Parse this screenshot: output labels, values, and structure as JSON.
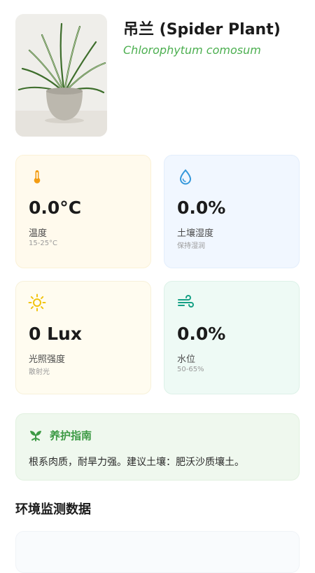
{
  "plant": {
    "name": "吊兰 (Spider Plant)",
    "scientific_name": "Chlorophytum comosum"
  },
  "metrics": [
    {
      "icon": "thermometer-icon",
      "value": "0.0°C",
      "label": "温度",
      "sub": "15-25°C",
      "accent": "#f39c12"
    },
    {
      "icon": "water-drop-icon",
      "value": "0.0%",
      "label": "土壤湿度",
      "sub": "保持湿润",
      "accent": "#3498db"
    },
    {
      "icon": "sun-icon",
      "value": "0 Lux",
      "label": "光照强度",
      "sub": "散射光",
      "accent": "#f1c40f"
    },
    {
      "icon": "wind-icon",
      "value": "0.0%",
      "label": "水位",
      "sub": "50-65%",
      "accent": "#16a085"
    }
  ],
  "care_guide": {
    "icon": "sprout-icon",
    "title": "养护指南",
    "text": "根系肉质，耐旱力强。建议土壤：肥沃沙质壤土。"
  },
  "section_title": "环境监测数据",
  "colors": {
    "brand_green": "#4caf50",
    "guide_green": "#3d9a45"
  }
}
